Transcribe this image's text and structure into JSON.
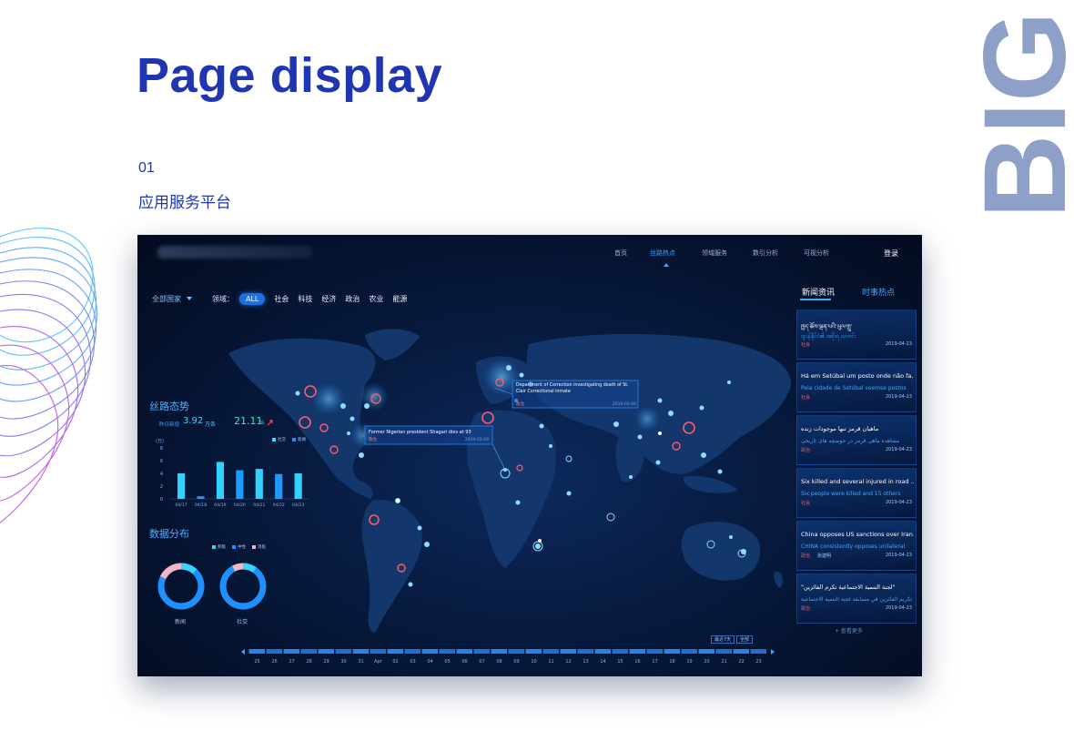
{
  "header": {
    "title": "Page display",
    "section_number": "01",
    "section_title": "应用服务平台",
    "side_word": "BIG"
  },
  "dashboard": {
    "nav": {
      "items": [
        "首页",
        "丝路热点",
        "领域服务",
        "数引分析",
        "可视分析"
      ],
      "active_index": 1,
      "login": "登录"
    },
    "filters": {
      "country": "全部国家",
      "domain_label": "领域：",
      "chips": [
        "ALL",
        "社会",
        "科技",
        "经济",
        "政治",
        "农业",
        "能源"
      ],
      "active_chip": "ALL"
    },
    "map": {
      "callouts": [
        {
          "title": "Department of Correction investigating death of St. Clair Correctional inmate",
          "tag": "政治",
          "date": "2019-02-08"
        },
        {
          "title": "Former Nigerian president Shagari dies at 93",
          "tag": "政治",
          "date": "2019-02-09"
        }
      ]
    },
    "trend_panel": {
      "title": "丝路态势",
      "new_label": "昨日新增",
      "new_value": "3.92",
      "new_unit": "万条",
      "growth_value": "21.11",
      "growth_unit": "%",
      "legend": [
        {
          "label": "社交",
          "color": "#32e0ff"
        },
        {
          "label": "新闻",
          "color": "#1e90ff"
        }
      ]
    },
    "bar_chart": {
      "y_unit": "(万)",
      "y_ticks": [
        "8",
        "6",
        "4",
        "2",
        "0"
      ],
      "categories": [
        "04/17",
        "04/18",
        "04/19",
        "04/20",
        "04/21",
        "04/22",
        "04/23"
      ],
      "values": [
        4,
        0.4,
        5.8,
        4.5,
        4.7,
        3.9,
        4.0
      ]
    },
    "distribution": {
      "title": "数据分布",
      "legend": [
        {
          "label": "积极",
          "color": "#36d6ff"
        },
        {
          "label": "中性",
          "color": "#1e90ff"
        },
        {
          "label": "消极",
          "color": "#f3b6c8"
        }
      ],
      "donuts": [
        {
          "label": "新闻",
          "shares": [
            0.12,
            0.7,
            0.18
          ]
        },
        {
          "label": "社交",
          "shares": [
            0.1,
            0.82,
            0.08
          ]
        }
      ]
    },
    "news": {
      "tabs": [
        "新闻资讯",
        "时事热点"
      ],
      "active_tab": 0,
      "items": [
        {
          "title": "ཁྱད་ཆོས་ལྡན་པའི་ཡུལ་གྲུ་",
          "sub": "ဂျပန်နိုင်ငံ၏ အစိုးရ သတင်း",
          "tag": "社会",
          "extra": "",
          "date": "2019-04-23"
        },
        {
          "title": "Há em Setúbal um posto onde não fa...",
          "sub": "Pela cidade de Setúbal veemse postos",
          "tag": "社会",
          "extra": "",
          "date": "2019-04-23"
        },
        {
          "title": "ماهیان قرمز تنها موجودات زنده",
          "sub": "مشاهده ماهی قرمز در حوضچه های تاریخی",
          "tag": "政治",
          "extra": "",
          "date": "2019-04-23"
        },
        {
          "title": "Six killed and several injured in road ...",
          "sub": "Six people were killed and 15 others",
          "tag": "社会",
          "extra": "",
          "date": "2019-04-23"
        },
        {
          "title": "China opposes US sanctions over Iran...",
          "sub": "CHINA consistently opposes unilateral",
          "tag": "政治",
          "extra": "张建明",
          "date": "2019-04-23"
        },
        {
          "title": "\"لجنة التنمية الاجتماعية تكرم الفائزين\"",
          "sub": "تم تكريم الفائزين في مسابقة لجنة التنمية الاجتماعية",
          "tag": "政治",
          "extra": "",
          "date": "2019-04-23"
        }
      ],
      "more": "+ 查看更多"
    },
    "timeline": {
      "controls": [
        "最近7天",
        "全部"
      ],
      "labels": [
        "25",
        "26",
        "27",
        "28",
        "29",
        "30",
        "31",
        "Apr",
        "02",
        "03",
        "04",
        "05",
        "06",
        "07",
        "08",
        "09",
        "10",
        "11",
        "12",
        "13",
        "14",
        "15",
        "16",
        "17",
        "18",
        "19",
        "20",
        "21",
        "22",
        "23"
      ]
    }
  }
}
